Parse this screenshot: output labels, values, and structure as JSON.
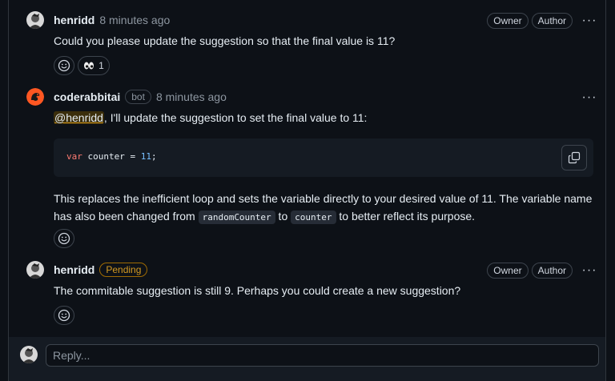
{
  "comments": [
    {
      "author": "henridd",
      "time": "8 minutes ago",
      "roles": [
        "Owner",
        "Author"
      ],
      "body": "Could you please update the suggestion so that the final value is 11?",
      "reactions": [
        {
          "icon": "eyes-icon",
          "count": "1"
        }
      ]
    },
    {
      "author": "coderabbitai",
      "badge": "bot",
      "time": "8 minutes ago",
      "mention": "@henridd",
      "intro": ", I'll update the suggestion to set the final value to 11:",
      "code": {
        "keyword": "var",
        "identifier": " counter = ",
        "number": "11",
        "end": ";"
      },
      "para_part1": "This replaces the inefficient loop and sets the variable directly to your desired value of 11. The variable name has also been changed from ",
      "code_from": "randomCounter",
      "para_to": " to ",
      "code_to": "counter",
      "para_part2": " to better reflect its purpose."
    },
    {
      "author": "henridd",
      "status": "Pending",
      "roles": [
        "Owner",
        "Author"
      ],
      "body": "The commitable suggestion is still 9. Perhaps you could create a new suggestion?"
    }
  ],
  "reply": {
    "placeholder": "Reply..."
  },
  "icons": {
    "more": "kebab-horizontal-icon",
    "emoji": "smiley-icon",
    "copy": "copy-icon"
  },
  "colors": {
    "background": "#0d1117",
    "pending": "#d29922",
    "border": "#30363d"
  }
}
